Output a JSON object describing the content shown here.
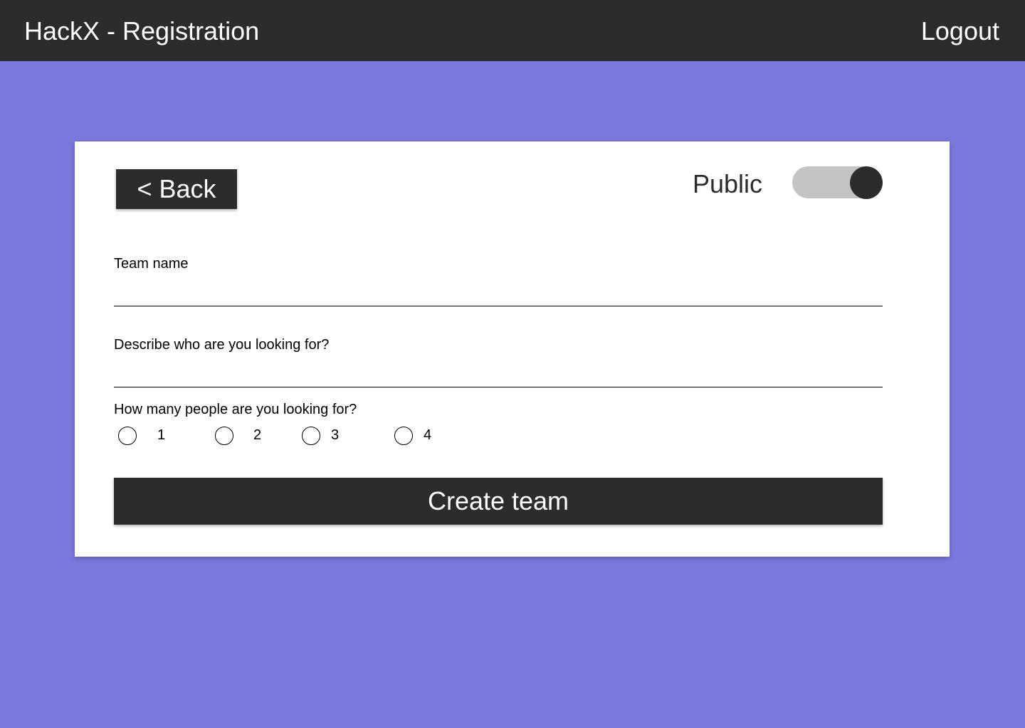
{
  "header": {
    "title": "HackX - Registration",
    "logout_label": "Logout"
  },
  "card": {
    "back_label": "< Back",
    "public_label": "Public",
    "public_toggle_on": true,
    "team_name": {
      "label": "Team name",
      "value": ""
    },
    "description": {
      "label": "Describe who are you looking for?",
      "value": ""
    },
    "people_count": {
      "label": "How many people are you looking for?",
      "options": [
        "1",
        "2",
        "3",
        "4"
      ],
      "selected": null
    },
    "create_label": "Create team"
  },
  "colors": {
    "background": "#7a78dc",
    "bar": "#2c2c2c",
    "toggle_track": "#c4c4c4",
    "card": "#ffffff"
  }
}
